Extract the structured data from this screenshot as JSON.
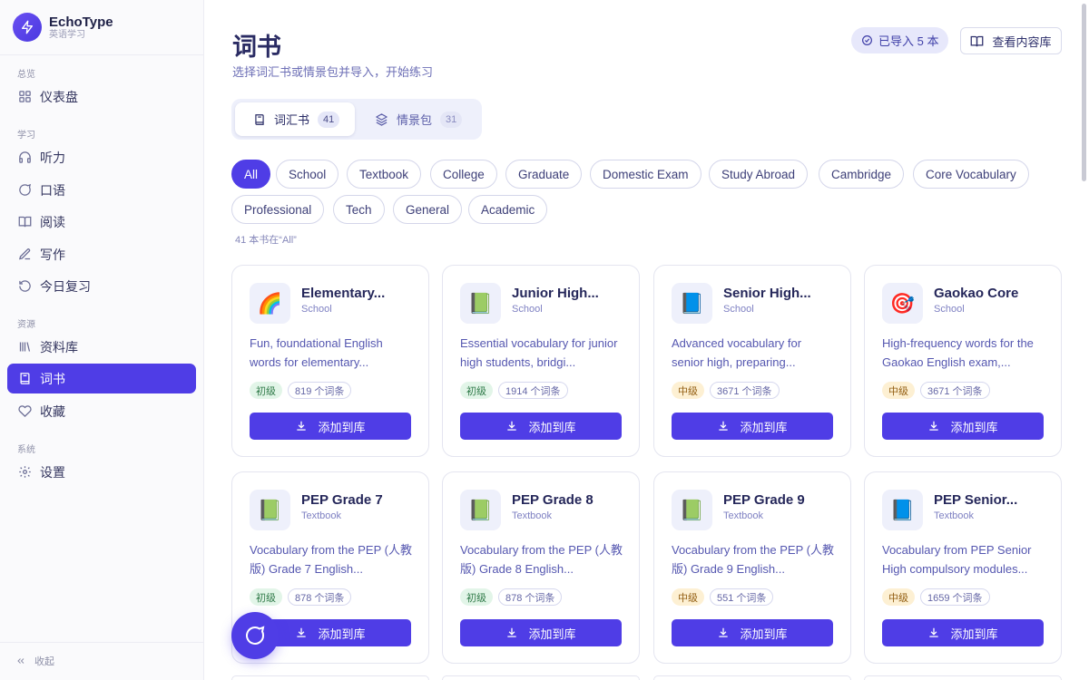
{
  "brand": {
    "name": "EchoType",
    "sub": "英语学习"
  },
  "sidebar": {
    "groups": [
      {
        "label": "总览"
      },
      {
        "label": "学习"
      },
      {
        "label": "资源"
      },
      {
        "label": "系统"
      }
    ],
    "items": [
      {
        "label": "仪表盘",
        "icon": "grid-icon"
      },
      {
        "label": "听力",
        "icon": "headphones-icon"
      },
      {
        "label": "口语",
        "icon": "chat-bubble-icon"
      },
      {
        "label": "阅读",
        "icon": "open-book-icon"
      },
      {
        "label": "写作",
        "icon": "pen-icon"
      },
      {
        "label": "今日复习",
        "icon": "rotate-icon"
      },
      {
        "label": "资料库",
        "icon": "library-icon"
      },
      {
        "label": "词书",
        "icon": "book-icon",
        "active": true
      },
      {
        "label": "收藏",
        "icon": "heart-icon"
      },
      {
        "label": "设置",
        "icon": "gear-icon"
      }
    ],
    "collapse_label": "收起"
  },
  "header": {
    "title": "词书",
    "subtitle": "选择词汇书或情景包并导入，开始练习",
    "imported_badge": "已导入 5 本",
    "view_library_label": "查看内容库"
  },
  "segments": [
    {
      "label": "词汇书",
      "count": "41",
      "active": true
    },
    {
      "label": "情景包",
      "count": "31",
      "active": false
    }
  ],
  "filters": {
    "chips": [
      "All",
      "School",
      "Textbook",
      "College",
      "Graduate",
      "Domestic Exam",
      "Study Abroad",
      "Cambridge",
      "Core Vocabulary",
      "Professional",
      "Tech",
      "General",
      "Academic"
    ],
    "active": "All",
    "status": "41 本书在“All”"
  },
  "add_label": "添加到库",
  "colors": {
    "accent": "#4f3de6",
    "level_green_bg": "#e2f5e8",
    "level_amber_bg": "#fdf0d3"
  },
  "cards": [
    {
      "title": "Elementary...",
      "category": "School",
      "emoji": "🌈",
      "desc": "Fun, foundational English words for elementary...",
      "level": "初级",
      "level_color": "green",
      "count": "819 个词条"
    },
    {
      "title": "Junior High...",
      "category": "School",
      "emoji": "📗",
      "desc": "Essential vocabulary for junior high students, bridgi...",
      "level": "初级",
      "level_color": "green",
      "count": "1914 个词条"
    },
    {
      "title": "Senior High...",
      "category": "School",
      "emoji": "📘",
      "desc": "Advanced vocabulary for senior high, preparing...",
      "level": "中级",
      "level_color": "amber",
      "count": "3671 个词条"
    },
    {
      "title": "Gaokao Core",
      "category": "School",
      "emoji": "🎯",
      "desc": "High-frequency words for the Gaokao English exam,...",
      "level": "中级",
      "level_color": "amber",
      "count": "3671 个词条"
    },
    {
      "title": "PEP Grade 7",
      "category": "Textbook",
      "emoji": "📗",
      "desc": "Vocabulary from the PEP (人教版) Grade 7 English...",
      "level": "初级",
      "level_color": "green",
      "count": "878 个词条"
    },
    {
      "title": "PEP Grade 8",
      "category": "Textbook",
      "emoji": "📗",
      "desc": "Vocabulary from the PEP (人教版) Grade 8 English...",
      "level": "初级",
      "level_color": "green",
      "count": "878 个词条"
    },
    {
      "title": "PEP Grade 9",
      "category": "Textbook",
      "emoji": "📗",
      "desc": "Vocabulary from the PEP (人教版) Grade 9 English...",
      "level": "中级",
      "level_color": "amber",
      "count": "551 个词条"
    },
    {
      "title": "PEP Senior...",
      "category": "Textbook",
      "emoji": "📘",
      "desc": "Vocabulary from PEP Senior High compulsory modules...",
      "level": "中级",
      "level_color": "amber",
      "count": "1659 个词条"
    }
  ]
}
